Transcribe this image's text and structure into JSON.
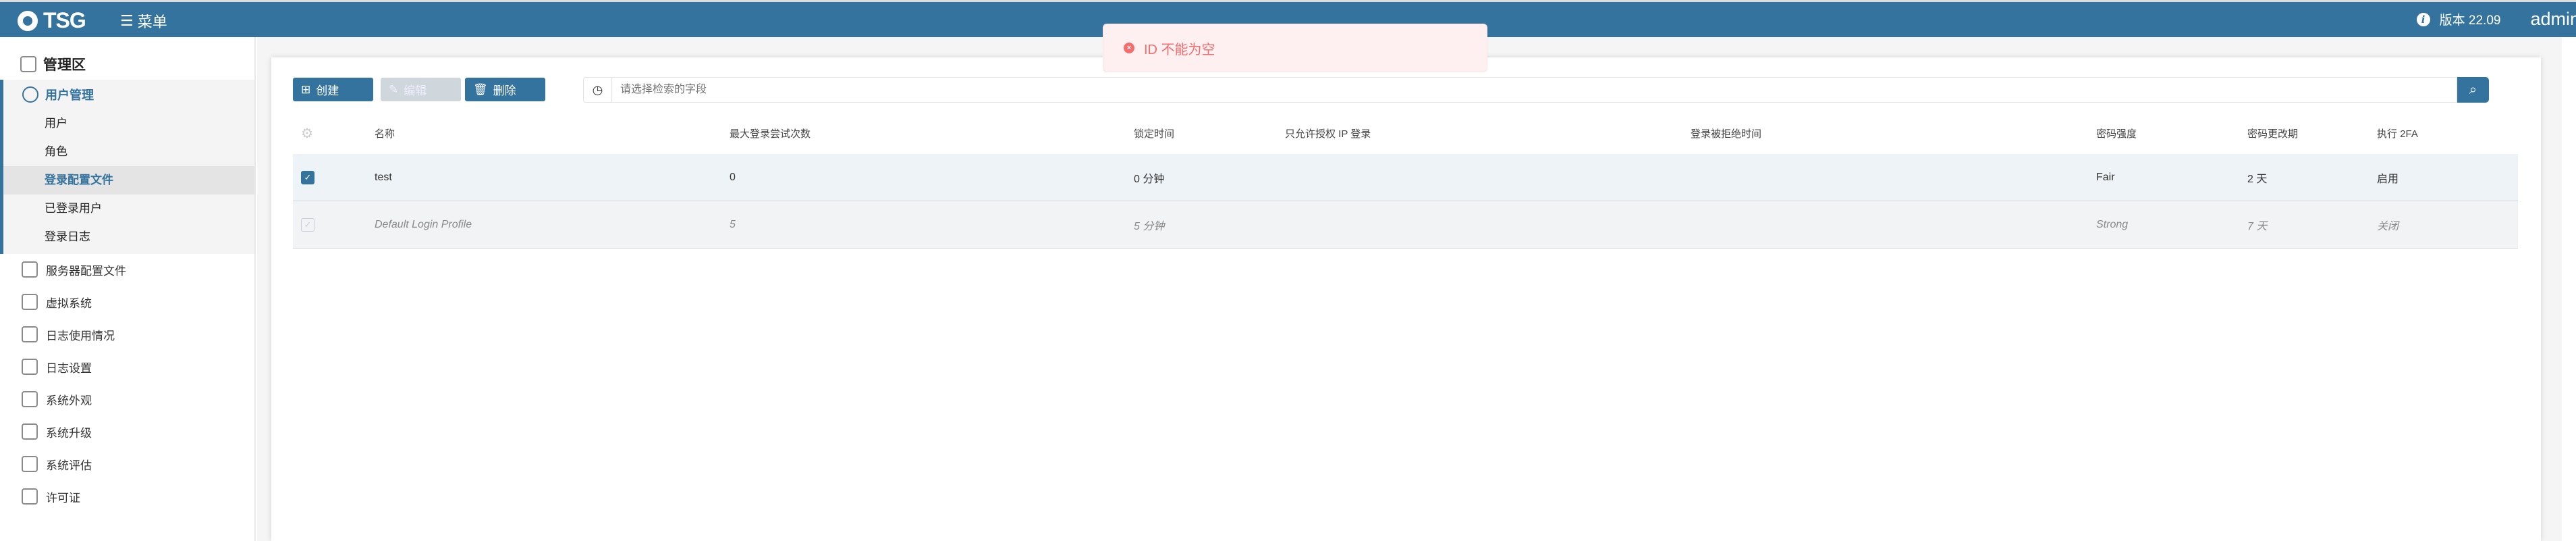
{
  "header": {
    "logo": "TSG",
    "menu": "菜单",
    "version": "版本 22.09",
    "user": "admin"
  },
  "sidebar": {
    "title": "管理区",
    "group": {
      "label": "用户管理",
      "items": [
        "用户",
        "角色",
        "登录配置文件",
        "已登录用户",
        "登录日志"
      ],
      "active": 2
    },
    "items": [
      {
        "label": "服务器配置文件",
        "icon": "server-gear-icon"
      },
      {
        "label": "虚拟系统",
        "icon": "layers-icon"
      },
      {
        "label": "日志使用情况",
        "icon": "log-chart-icon"
      },
      {
        "label": "日志设置",
        "icon": "log-gear-icon"
      },
      {
        "label": "系统外观",
        "icon": "palette-icon"
      },
      {
        "label": "系统升级",
        "icon": "upgrade-icon"
      },
      {
        "label": "系统评估",
        "icon": "clipboard-search-icon"
      },
      {
        "label": "许可证",
        "icon": "license-icon"
      }
    ]
  },
  "toolbar": {
    "create": "创建",
    "edit": "编辑",
    "delete": "删除",
    "search_placeholder": "请选择检索的字段"
  },
  "table": {
    "columns": [
      "名称",
      "最大登录尝试次数",
      "锁定时间",
      "只允许授权 IP 登录",
      "登录被拒绝时间",
      "密码强度",
      "密码更改期",
      "执行 2FA"
    ],
    "rows": [
      [
        "test",
        "0",
        "0 分钟",
        "",
        "",
        "Fair",
        "2 天",
        "启用"
      ],
      [
        "Default Login Profile",
        "5",
        "5 分钟",
        "",
        "",
        "Strong",
        "7 天",
        "关闭"
      ]
    ]
  },
  "toast": {
    "message": "ID 不能为空"
  },
  "colors": {
    "brand": "#33739e",
    "error": "#f56c6c"
  }
}
